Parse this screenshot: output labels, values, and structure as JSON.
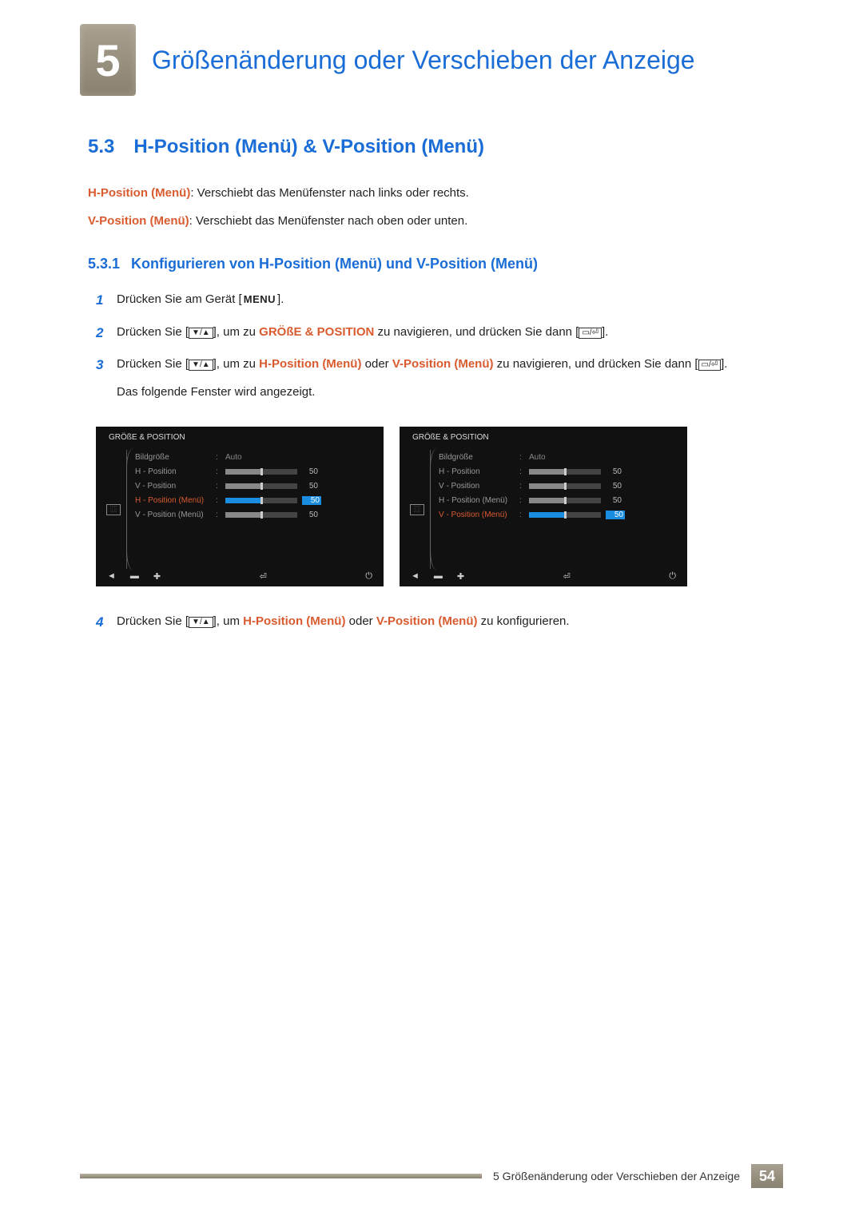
{
  "chapter": {
    "number": "5",
    "title": "Größenänderung oder Verschieben der Anzeige"
  },
  "section": {
    "number": "5.3",
    "title": "H-Position (Menü) & V-Position (Menü)",
    "desc1_label": "H-Position (Menü)",
    "desc1_text": ": Verschiebt das Menüfenster nach links oder rechts.",
    "desc2_label": "V-Position (Menü)",
    "desc2_text": ": Verschiebt das Menüfenster nach oben oder unten."
  },
  "subsection": {
    "number": "5.3.1",
    "title": "Konfigurieren von H-Position (Menü) und V-Position (Menü)"
  },
  "steps": {
    "s1_pre": "Drücken Sie am Gerät [",
    "s1_btn": "MENU",
    "s1_post": "].",
    "s2_a": "Drücken Sie [",
    "s2_icons": "▼/▲",
    "s2_b": "], um zu ",
    "s2_hl": "GRÖßE & POSITION",
    "s2_c": " zu navigieren, und drücken Sie dann [",
    "s2_icons2": "▭/⏎",
    "s2_d": "].",
    "s3_a": "Drücken Sie [",
    "s3_icons": "▼/▲",
    "s3_b": "], um zu ",
    "s3_hl1": "H-Position (Menü)",
    "s3_mid": " oder ",
    "s3_hl2": "V-Position (Menü)",
    "s3_c": " zu navigieren, und drücken Sie dann [",
    "s3_icons2": "▭/⏎",
    "s3_d": "].",
    "s3_post": "Das folgende Fenster wird angezeigt.",
    "s4_a": "Drücken Sie [",
    "s4_icons": "▼/▲",
    "s4_b": "], um ",
    "s4_hl1": "H-Position (Menü)",
    "s4_mid": " oder ",
    "s4_hl2": "V-Position (Menü)",
    "s4_c": " zu konfigurieren."
  },
  "osd": {
    "title": "GRÖßE & POSITION",
    "items": [
      {
        "label": "Bildgröße",
        "value": "Auto",
        "type": "text"
      },
      {
        "label": "H - Position",
        "value": "50",
        "type": "slider",
        "fill": 50
      },
      {
        "label": "V - Position",
        "value": "50",
        "type": "slider",
        "fill": 50
      },
      {
        "label": "H - Position (Menü)",
        "value": "50",
        "type": "slider",
        "fill": 50
      },
      {
        "label": "V - Position (Menü)",
        "value": "50",
        "type": "slider",
        "fill": 50
      }
    ],
    "active_left_index": 3,
    "active_right_index": 4,
    "bottom_icons": [
      "◄",
      "▬",
      "✚",
      "⏎",
      "⏻"
    ]
  },
  "footer": {
    "text": "5 Größenänderung oder Verschieben der Anzeige",
    "page": "54"
  }
}
